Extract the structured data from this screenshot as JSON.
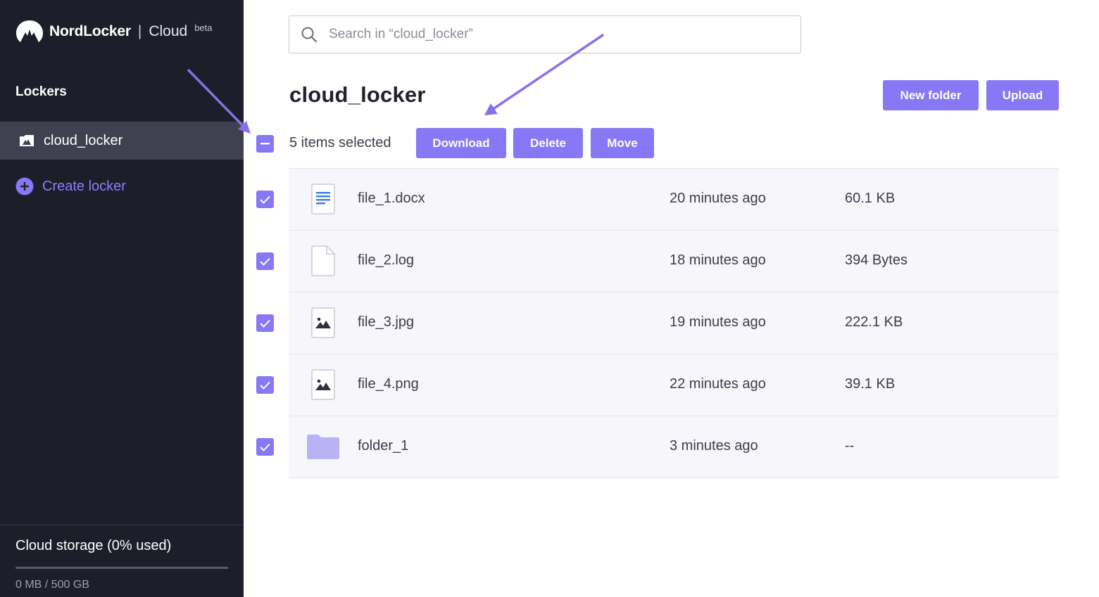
{
  "app": {
    "brand_name": "NordLocker",
    "brand_separator": "|",
    "brand_product": "Cloud",
    "brand_tag": "beta"
  },
  "sidebar": {
    "section_title": "Lockers",
    "lockers": [
      {
        "label": "cloud_locker",
        "active": true
      }
    ],
    "create_label": "Create locker",
    "storage": {
      "title": "Cloud storage (0% used)",
      "used_percent": 0,
      "amount": "0 MB / 500 GB"
    }
  },
  "search": {
    "placeholder": "Search in “cloud_locker”",
    "value": ""
  },
  "main": {
    "title": "cloud_locker",
    "new_folder_label": "New folder",
    "upload_label": "Upload",
    "selection_text": "5 items selected",
    "download_label": "Download",
    "delete_label": "Delete",
    "move_label": "Move"
  },
  "files": [
    {
      "name": "file_1.docx",
      "modified": "20 minutes ago",
      "size": "60.1 KB",
      "icon": "document-icon",
      "checked": true
    },
    {
      "name": "file_2.log",
      "modified": "18 minutes ago",
      "size": "394 Bytes",
      "icon": "file-icon",
      "checked": true
    },
    {
      "name": "file_3.jpg",
      "modified": "19 minutes ago",
      "size": "222.1 KB",
      "icon": "image-icon",
      "checked": true
    },
    {
      "name": "file_4.png",
      "modified": "22 minutes ago",
      "size": "39.1 KB",
      "icon": "image-icon",
      "checked": true
    },
    {
      "name": "folder_1",
      "modified": "3 minutes ago",
      "size": "--",
      "icon": "folder-icon",
      "checked": true
    }
  ],
  "colors": {
    "sidebar_bg": "#1c1e2a",
    "sidebar_active": "#3f4150",
    "accent": "#8878f5",
    "accent_text": "#8d7ff7",
    "row_bg": "#f7f7fb",
    "annotation_arrow": "#8a6fe8"
  }
}
